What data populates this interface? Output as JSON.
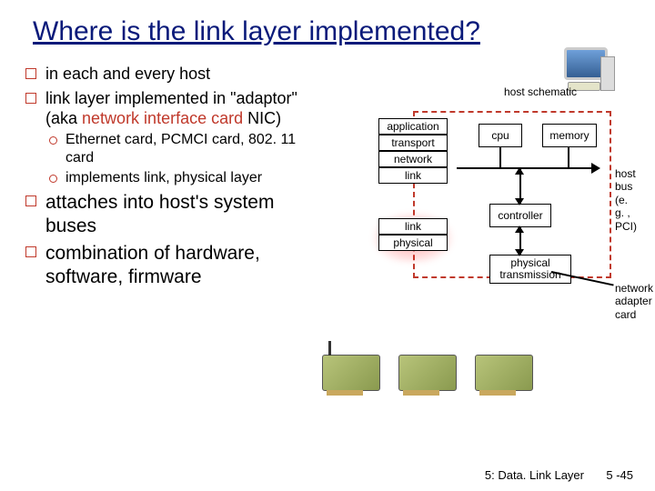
{
  "title": "Where is the link layer implemented?",
  "bullets": {
    "b1": "in each and every host",
    "b2a": "link layer implemented in \"adaptor\" (aka ",
    "b2_hl1": "network interface card",
    "b2b": " NIC)",
    "b2_sub1": "Ethernet card, PCMCI card, 802. 11 card",
    "b2_sub2": "implements link, physical layer",
    "b3": "attaches into host's system buses",
    "b4": "combination of hardware, software, firmware"
  },
  "diagram": {
    "host_schematic": "host schematic",
    "stack": {
      "application": "application",
      "transport": "transport",
      "network": "network",
      "link_upper": "link",
      "link_lower": "link",
      "physical": "physical"
    },
    "cpu": "cpu",
    "memory": "memory",
    "controller": "controller",
    "physical_transmission": "physical transmission",
    "host_bus": "host bus (e. g. , PCI)",
    "nic_label": "network adapter card"
  },
  "footer": {
    "chapter": "5: Data. Link Layer",
    "page": "5 -45"
  }
}
